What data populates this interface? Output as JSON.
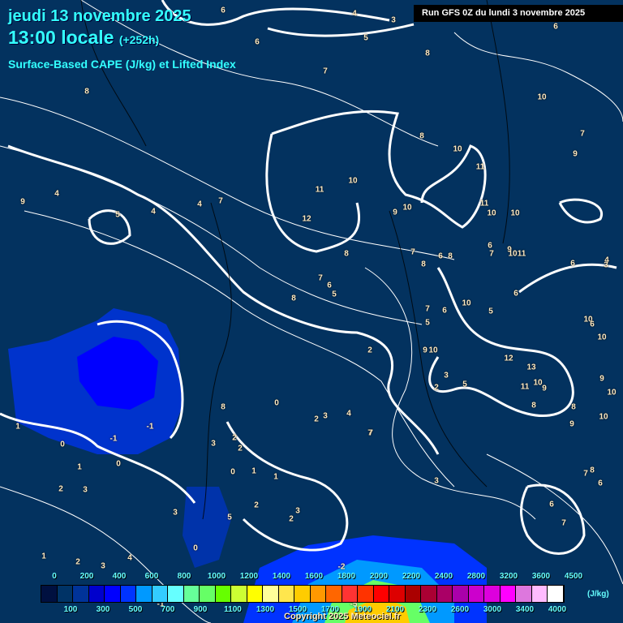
{
  "header": {
    "date": "jeudi 13 novembre 2025",
    "time": "13:00 locale",
    "lead": "(+252h)",
    "product": "Surface-Based CAPE (J/kg) et Lifted Index",
    "run": "Run GFS 0Z du lundi 3 novembre 2025"
  },
  "legend": {
    "colors": [
      "#001040",
      "#003366",
      "#003399",
      "#0000cc",
      "#0000ff",
      "#0033ff",
      "#0099ff",
      "#33ccff",
      "#66ffff",
      "#66ff99",
      "#66ff66",
      "#66ff00",
      "#ccff33",
      "#ffff00",
      "#ffff99",
      "#ffe64d",
      "#ffcc00",
      "#ff9900",
      "#ff6600",
      "#ff3333",
      "#ff3300",
      "#ff0000",
      "#dd0000",
      "#aa0000",
      "#aa0033",
      "#aa0066",
      "#aa00aa",
      "#cc00cc",
      "#dd00dd",
      "#ff00ff",
      "#dd77dd",
      "#ffbbff",
      "#ffffff"
    ],
    "top_labels": [
      "0",
      "200",
      "400",
      "600",
      "800",
      "1000",
      "1200",
      "1400",
      "1600",
      "1800",
      "2000",
      "2200",
      "2400",
      "2800",
      "3200",
      "3600",
      "4500"
    ],
    "bottom_labels": [
      "100",
      "300",
      "500",
      "700",
      "900",
      "1100",
      "1300",
      "1500",
      "1700",
      "1900",
      "2100",
      "2300",
      "2600",
      "3000",
      "3400",
      "4000"
    ],
    "unit": "(J/kg)"
  },
  "contour_labels": [
    "6",
    "4",
    "3",
    "6",
    "5",
    "6",
    "7",
    "8",
    "8",
    "7",
    "8",
    "10",
    "9",
    "10",
    "11",
    "10",
    "12",
    "11",
    "9",
    "10",
    "11",
    "10",
    "10",
    "9",
    "4",
    "4",
    "5",
    "4",
    "7",
    "8",
    "8",
    "7",
    "6",
    "5",
    "8",
    "7",
    "6",
    "8",
    "6",
    "7",
    "9",
    "10",
    "11",
    "6",
    "4",
    "3",
    "5",
    "6",
    "7",
    "10",
    "5",
    "6",
    "10",
    "10",
    "2",
    "9",
    "10",
    "2",
    "3",
    "5",
    "12",
    "13",
    "11",
    "10",
    "9",
    "8",
    "8",
    "9",
    "10",
    "9",
    "10",
    "2",
    "3",
    "4",
    "7",
    "8",
    "0",
    "1",
    "0",
    "-1",
    "-1",
    "2",
    "3",
    "2",
    "3",
    "0",
    "1",
    "1",
    "2",
    "3",
    "2",
    "0",
    "0",
    "1",
    "2",
    "3",
    "1",
    "2",
    "3",
    "4",
    "5",
    "-2",
    "-5",
    "-1",
    "7",
    "8",
    "6",
    "6",
    "7",
    "6",
    "7",
    "3"
  ],
  "copyright": "Copyright 2025 Meteociel.fr"
}
